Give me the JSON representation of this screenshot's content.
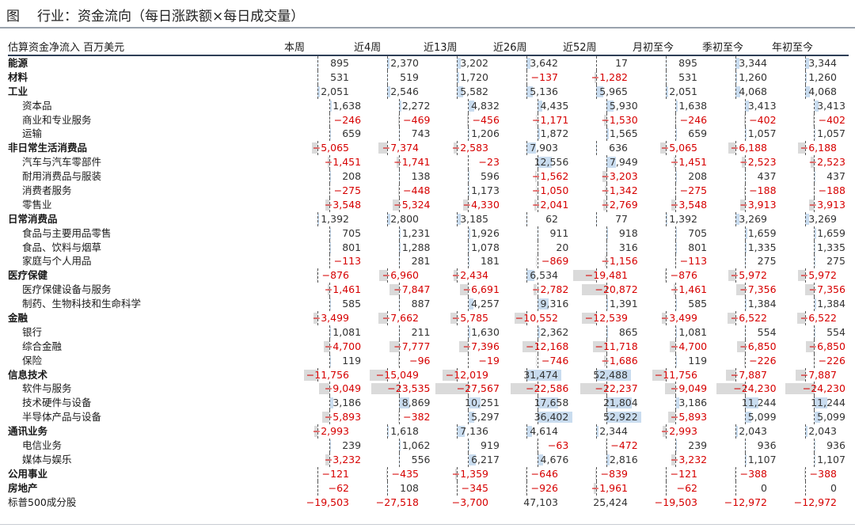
{
  "figure": {
    "lead": "图",
    "title": "行业：资金流向（每日涨跌额×每日成交量）"
  },
  "header": {
    "label": "估算资金净流入 百万美元",
    "columns": [
      "本周",
      "近4周",
      "近13周",
      "近26周",
      "近52周",
      "月初至今",
      "季初至今",
      "年初至今"
    ]
  },
  "colors": {
    "negative_text": "#d60000",
    "positive_bar": "#c9dcef",
    "negative_bar": "#dadada"
  },
  "rows": [
    {
      "name": "能源",
      "level": 0,
      "values": [
        895,
        2370,
        3202,
        3642,
        17,
        895,
        3344,
        3344
      ]
    },
    {
      "name": "材料",
      "level": 0,
      "values": [
        531,
        519,
        1720,
        -137,
        -1282,
        531,
        1260,
        1260
      ]
    },
    {
      "name": "工业",
      "level": 0,
      "values": [
        2051,
        2546,
        5582,
        5136,
        5965,
        2051,
        4068,
        4068
      ]
    },
    {
      "name": "资本品",
      "level": 1,
      "values": [
        1638,
        2272,
        4832,
        4435,
        5930,
        1638,
        3413,
        3413
      ]
    },
    {
      "name": "商业和专业服务",
      "level": 1,
      "values": [
        -246,
        -469,
        -456,
        -1171,
        -1530,
        -246,
        -402,
        -402
      ]
    },
    {
      "name": "运输",
      "level": 1,
      "values": [
        659,
        743,
        1206,
        1872,
        1565,
        659,
        1057,
        1057
      ]
    },
    {
      "name": "非日常生活消费品",
      "level": 0,
      "values": [
        -5065,
        -7374,
        -2583,
        7903,
        636,
        -5065,
        -6188,
        -6188
      ]
    },
    {
      "name": "汽车与汽车零部件",
      "level": 1,
      "values": [
        -1451,
        -1741,
        -23,
        12556,
        7949,
        -1451,
        -2523,
        -2523
      ]
    },
    {
      "name": "耐用消费品与服装",
      "level": 1,
      "values": [
        208,
        138,
        596,
        -1562,
        -3203,
        208,
        437,
        437
      ]
    },
    {
      "name": "消费者服务",
      "level": 1,
      "values": [
        -275,
        -448,
        1173,
        -1050,
        -1342,
        -275,
        -188,
        -188
      ]
    },
    {
      "name": "零售业",
      "level": 1,
      "values": [
        -3548,
        -5324,
        -4330,
        -2041,
        -2769,
        -3548,
        -3913,
        -3913
      ]
    },
    {
      "name": "日常消费品",
      "level": 0,
      "values": [
        1392,
        2800,
        3185,
        62,
        77,
        1392,
        3269,
        3269
      ]
    },
    {
      "name": "食品与主要用品零售",
      "level": 1,
      "values": [
        705,
        1231,
        1926,
        911,
        918,
        705,
        1659,
        1659
      ]
    },
    {
      "name": "食品、饮料与烟草",
      "level": 1,
      "values": [
        801,
        1288,
        1078,
        20,
        316,
        801,
        1335,
        1335
      ]
    },
    {
      "name": "家庭与个人用品",
      "level": 1,
      "values": [
        -113,
        281,
        181,
        -869,
        -1156,
        -113,
        275,
        275
      ]
    },
    {
      "name": "医疗保健",
      "level": 0,
      "values": [
        -876,
        -6960,
        -2434,
        6534,
        -19481,
        -876,
        -5972,
        -5972
      ]
    },
    {
      "name": "医疗保健设备与服务",
      "level": 1,
      "values": [
        -1461,
        -7847,
        -6691,
        -2782,
        -20872,
        -1461,
        -7356,
        -7356
      ]
    },
    {
      "name": "制药、生物科技和生命科学",
      "level": 1,
      "values": [
        585,
        887,
        4257,
        9316,
        1391,
        585,
        1384,
        1384
      ]
    },
    {
      "name": "金融",
      "level": 0,
      "values": [
        -3499,
        -7662,
        -5785,
        -10552,
        -12539,
        -3499,
        -6522,
        -6522
      ]
    },
    {
      "name": "银行",
      "level": 1,
      "values": [
        1081,
        211,
        1630,
        2362,
        865,
        1081,
        554,
        554
      ]
    },
    {
      "name": "综合金融",
      "level": 1,
      "values": [
        -4700,
        -7777,
        -7396,
        -12168,
        -11718,
        -4700,
        -6850,
        -6850
      ]
    },
    {
      "name": "保险",
      "level": 1,
      "values": [
        119,
        -96,
        -19,
        -746,
        -1686,
        119,
        -226,
        -226
      ]
    },
    {
      "name": "信息技术",
      "level": 0,
      "values": [
        -11756,
        -15049,
        -12019,
        31474,
        52488,
        -11756,
        -7887,
        -7887
      ]
    },
    {
      "name": "软件与服务",
      "level": 1,
      "values": [
        -9049,
        -23535,
        -27567,
        -22586,
        -22237,
        -9049,
        -24230,
        -24230
      ]
    },
    {
      "name": "技术硬件与设备",
      "level": 1,
      "values": [
        3186,
        8869,
        10251,
        17658,
        21804,
        3186,
        11244,
        11244
      ]
    },
    {
      "name": "半导体产品与设备",
      "level": 1,
      "values": [
        -5893,
        -382,
        5297,
        36402,
        52922,
        -5893,
        5099,
        5099
      ]
    },
    {
      "name": "通讯业务",
      "level": 0,
      "values": [
        -2993,
        1618,
        7136,
        4614,
        2344,
        -2993,
        2043,
        2043
      ]
    },
    {
      "name": "电信业务",
      "level": 1,
      "values": [
        239,
        1062,
        919,
        -63,
        -472,
        239,
        936,
        936
      ]
    },
    {
      "name": "媒体与娱乐",
      "level": 1,
      "values": [
        -3232,
        556,
        6217,
        4676,
        2816,
        -3232,
        1107,
        1107
      ]
    },
    {
      "name": "公用事业",
      "level": 0,
      "values": [
        -121,
        -435,
        -1359,
        -646,
        -839,
        -121,
        -388,
        -388
      ]
    },
    {
      "name": "房地产",
      "level": 0,
      "values": [
        -62,
        108,
        -345,
        -926,
        -1961,
        -62,
        0,
        0
      ]
    }
  ],
  "total": {
    "name": "标普500成分股",
    "values": [
      -19503,
      -27518,
      -3700,
      47103,
      25424,
      -19503,
      -12972,
      -12972
    ]
  }
}
